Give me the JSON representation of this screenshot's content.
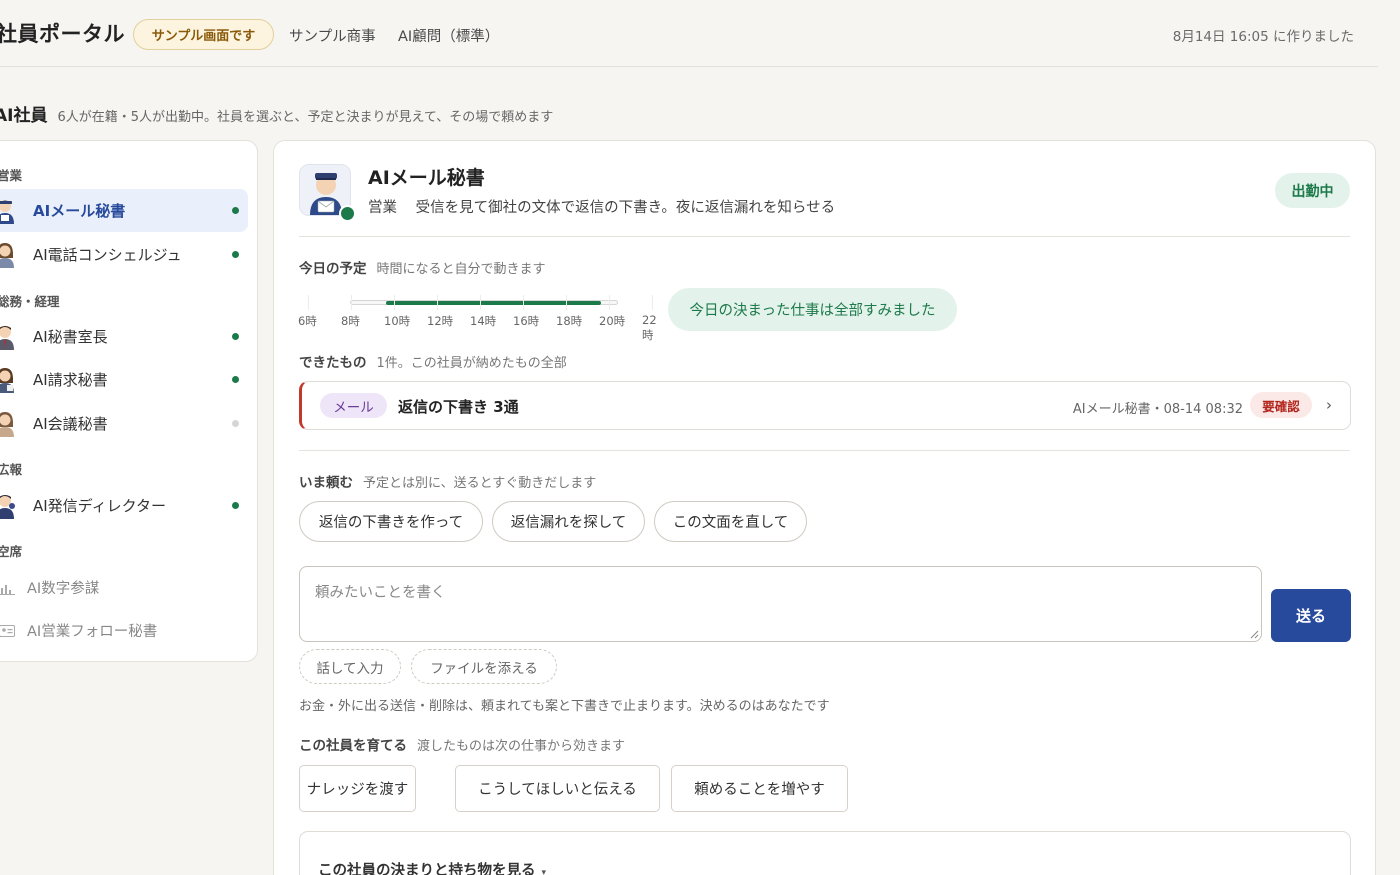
{
  "header": {
    "app_title": "社員ポータル",
    "sample_badge": "サンプル画面です",
    "company": "サンプル商事",
    "plan": "AI顧問（標準）",
    "created": "8月14日 16:05 に作りました"
  },
  "section": {
    "title": "AI社員",
    "subtitle": "6人が在籍・5人が出勤中。社員を選ぶと、予定と決まりが見えて、その場で頼めます"
  },
  "sidebar": {
    "groups": [
      {
        "label": "営業"
      },
      {
        "label": "総務・経理"
      },
      {
        "label": "広報"
      },
      {
        "label": "空席"
      }
    ],
    "items": [
      {
        "label": "AIメール秘書",
        "status": "on",
        "active": true
      },
      {
        "label": "AI電話コンシェルジュ",
        "status": "on"
      },
      {
        "label": "AI秘書室長",
        "status": "on"
      },
      {
        "label": "AI請求秘書",
        "status": "on"
      },
      {
        "label": "AI会議秘書",
        "status": "off"
      },
      {
        "label": "AI発信ディレクター",
        "status": "on"
      },
      {
        "label": "AI数字参謀",
        "status": "vacant",
        "icon": "chart-icon"
      },
      {
        "label": "AI営業フォロー秘書",
        "status": "vacant",
        "icon": "id-card-icon"
      }
    ]
  },
  "employee": {
    "name": "AIメール秘書",
    "department": "営業",
    "description": "受信を見て御社の文体で返信の下書き。夜に返信漏れを知らせる",
    "status": "出勤中"
  },
  "schedule": {
    "label": "今日の予定",
    "sub": "時間になると自分で動きます",
    "hours": [
      "6時",
      "8時",
      "10時",
      "12時",
      "14時",
      "16時",
      "18時",
      "20時",
      "22時"
    ],
    "range_start_hour": 10,
    "range_end_hour": 20,
    "done_message": "今日の決まった仕事は全部すみました"
  },
  "outputs": {
    "label": "できたもの",
    "sub": "1件。この社員が納めたもの全部",
    "items": [
      {
        "tag": "メール",
        "title": "返信の下書き 3通",
        "meta": "AIメール秘書・08-14 08:32",
        "status": "要確認"
      }
    ]
  },
  "request": {
    "label": "いま頼む",
    "sub": "予定とは別に、送るとすぐ動きだします",
    "quick_actions": [
      "返信の下書きを作って",
      "返信漏れを探して",
      "この文面を直して"
    ],
    "placeholder": "頼みたいことを書く",
    "send": "送る",
    "voice": "話して入力",
    "attach": "ファイルを添える",
    "notice": "お金・外に出る送信・削除は、頼まれても案と下書きで止まります。決めるのはあなたです"
  },
  "train": {
    "label": "この社員を育てる",
    "sub": "渡したものは次の仕事から効きます",
    "actions": [
      "ナレッジを渡す",
      "こうしてほしいと伝える",
      "頼めることを増やす"
    ]
  },
  "details": {
    "summary": "この社員の決まりと持ち物を見る",
    "arrow": "▾"
  },
  "colors": {
    "accent": "#274a9c",
    "on_duty": "#1c7a4a",
    "warning": "#b3261e"
  }
}
